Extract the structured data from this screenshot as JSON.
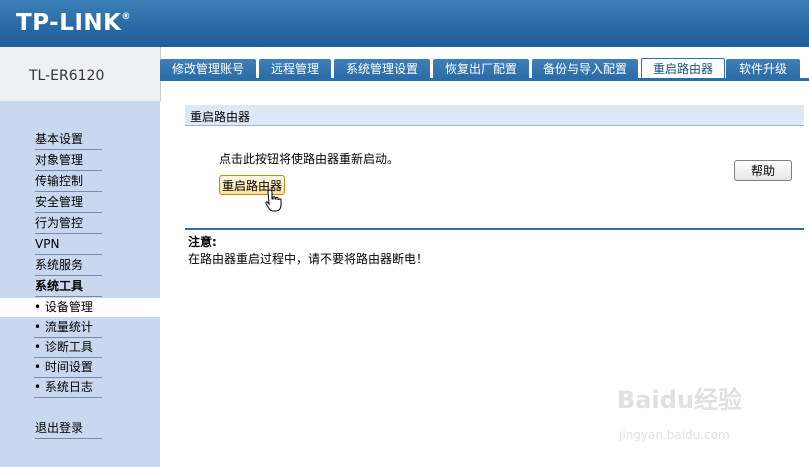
{
  "header": {
    "logo": "TP-LINK",
    "logo_mark": "®"
  },
  "model": "TL-ER6120",
  "tabs": [
    {
      "label": "修改管理账号",
      "active": false
    },
    {
      "label": "远程管理",
      "active": false
    },
    {
      "label": "系统管理设置",
      "active": false
    },
    {
      "label": "恢复出厂配置",
      "active": false
    },
    {
      "label": "备份与导入配置",
      "active": false
    },
    {
      "label": "重启路由器",
      "active": true
    },
    {
      "label": "软件升级",
      "active": false
    }
  ],
  "sidebar": {
    "items": [
      {
        "label": "基本设置"
      },
      {
        "label": "对象管理"
      },
      {
        "label": "传输控制"
      },
      {
        "label": "安全管理"
      },
      {
        "label": "行为管控"
      },
      {
        "label": "VPN"
      },
      {
        "label": "系统服务"
      },
      {
        "label": "系统工具"
      }
    ],
    "subitems": [
      {
        "label": "• 设备管理",
        "selected": true
      },
      {
        "label": "• 流量统计",
        "selected": false
      },
      {
        "label": "• 诊断工具",
        "selected": false
      },
      {
        "label": "• 时间设置",
        "selected": false
      },
      {
        "label": "• 系统日志",
        "selected": false
      }
    ],
    "logout": "退出登录"
  },
  "main": {
    "section_title": "重启路由器",
    "description": "点击此按钮将使路由器重新启动。",
    "restart_button": "重启路由器",
    "help_button": "帮助",
    "note_title": "注意:",
    "note_text": "在路由器重启过程中，请不要将路由器断电！"
  },
  "watermark": {
    "main": "Baidu经验",
    "sub": "jingyan.baidu.com"
  },
  "colors": {
    "header": "#2a6aa6",
    "sidebar": "#c9d7ef",
    "section_bar": "#dde8f6",
    "accent_button": "#ffdf9a"
  }
}
